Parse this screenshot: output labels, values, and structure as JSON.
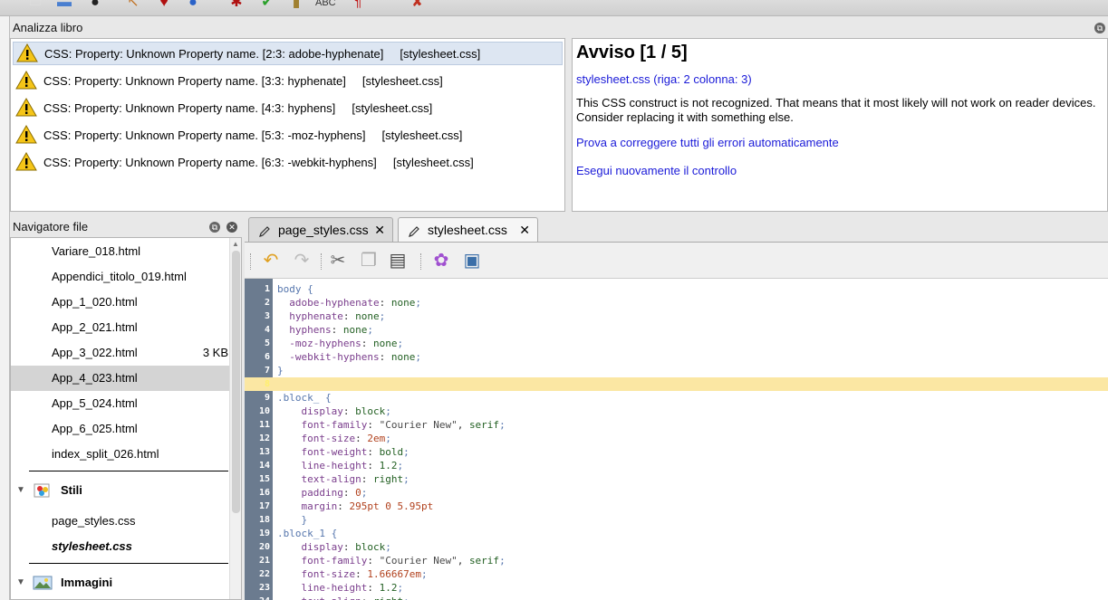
{
  "analyze_panel": {
    "title": "Analizza libro",
    "issues": [
      {
        "text": "CSS: Property: Unknown Property name. [2:3: adobe-hyphenate]     [stylesheet.css]",
        "selected": true
      },
      {
        "text": "CSS: Property: Unknown Property name. [3:3: hyphenate]     [stylesheet.css]",
        "selected": false
      },
      {
        "text": "CSS: Property: Unknown Property name. [4:3: hyphens]     [stylesheet.css]",
        "selected": false
      },
      {
        "text": "CSS: Property: Unknown Property name. [5:3: -moz-hyphens]     [stylesheet.css]",
        "selected": false
      },
      {
        "text": "CSS: Property: Unknown Property name. [6:3: -webkit-hyphens]     [stylesheet.css]",
        "selected": false
      }
    ]
  },
  "detail": {
    "heading": "Avviso [1 / 5]",
    "location_link": "stylesheet.css (riga: 2 colonna: 3)",
    "description": "This CSS construct is not recognized. That means that it most likely will not work on reader devices. Consider replacing it with something else.",
    "fix_all_link": "Prova a correggere tutti gli errori automaticamente",
    "recheck_link": "Esegui nuovamente il controllo"
  },
  "file_navigator": {
    "title": "Navigatore file",
    "files": [
      {
        "name": "Variare_018.html",
        "size": "",
        "selected": false
      },
      {
        "name": "Appendici_titolo_019.html",
        "size": "",
        "selected": false
      },
      {
        "name": "App_1_020.html",
        "size": "",
        "selected": false
      },
      {
        "name": "App_2_021.html",
        "size": "",
        "selected": false
      },
      {
        "name": "App_3_022.html",
        "size": "3 KB",
        "selected": false
      },
      {
        "name": "App_4_023.html",
        "size": "",
        "selected": true
      },
      {
        "name": "App_5_024.html",
        "size": "",
        "selected": false
      },
      {
        "name": "App_6_025.html",
        "size": "",
        "selected": false
      },
      {
        "name": "index_split_026.html",
        "size": "",
        "selected": false
      }
    ],
    "styles_folder": "Stili",
    "styles": [
      {
        "name": "page_styles.css",
        "active": false
      },
      {
        "name": "stylesheet.css",
        "active": true
      }
    ],
    "images_folder": "Immagini"
  },
  "tabs": [
    {
      "label": "page_styles.css",
      "active": false
    },
    {
      "label": "stylesheet.css",
      "active": true
    }
  ],
  "editor": {
    "current_line": 8,
    "lines": [
      [
        {
          "t": "body {",
          "c": "c-sel"
        }
      ],
      [
        {
          "t": "  adobe-hyphenate",
          "c": "c-prop"
        },
        {
          "t": ": ",
          "c": "c-punct"
        },
        {
          "t": "none",
          "c": "c-val"
        },
        {
          "t": ";",
          "c": "c-brace"
        }
      ],
      [
        {
          "t": "  hyphenate",
          "c": "c-prop"
        },
        {
          "t": ": ",
          "c": "c-punct"
        },
        {
          "t": "none",
          "c": "c-val"
        },
        {
          "t": ";",
          "c": "c-brace"
        }
      ],
      [
        {
          "t": "  hyphens",
          "c": "c-prop"
        },
        {
          "t": ": ",
          "c": "c-punct"
        },
        {
          "t": "none",
          "c": "c-val"
        },
        {
          "t": ";",
          "c": "c-brace"
        }
      ],
      [
        {
          "t": "  -moz-hyphens",
          "c": "c-prop"
        },
        {
          "t": ": ",
          "c": "c-punct"
        },
        {
          "t": "none",
          "c": "c-val"
        },
        {
          "t": ";",
          "c": "c-brace"
        }
      ],
      [
        {
          "t": "  -webkit-hyphens",
          "c": "c-prop"
        },
        {
          "t": ": ",
          "c": "c-punct"
        },
        {
          "t": "none",
          "c": "c-val"
        },
        {
          "t": ";",
          "c": "c-brace"
        }
      ],
      [
        {
          "t": "}",
          "c": "c-brace"
        }
      ],
      [],
      [
        {
          "t": ".block_ {",
          "c": "c-sel"
        }
      ],
      [
        {
          "t": "    display",
          "c": "c-prop"
        },
        {
          "t": ": ",
          "c": "c-punct"
        },
        {
          "t": "block",
          "c": "c-val"
        },
        {
          "t": ";",
          "c": "c-brace"
        }
      ],
      [
        {
          "t": "    font-family",
          "c": "c-prop"
        },
        {
          "t": ": ",
          "c": "c-punct"
        },
        {
          "t": "\"Courier New\"",
          "c": "c-str"
        },
        {
          "t": ", ",
          "c": "c-punct"
        },
        {
          "t": "serif",
          "c": "c-val"
        },
        {
          "t": ";",
          "c": "c-brace"
        }
      ],
      [
        {
          "t": "    font-size",
          "c": "c-prop"
        },
        {
          "t": ": ",
          "c": "c-punct"
        },
        {
          "t": "2em",
          "c": "c-num"
        },
        {
          "t": ";",
          "c": "c-brace"
        }
      ],
      [
        {
          "t": "    font-weight",
          "c": "c-prop"
        },
        {
          "t": ": ",
          "c": "c-punct"
        },
        {
          "t": "bold",
          "c": "c-val"
        },
        {
          "t": ";",
          "c": "c-brace"
        }
      ],
      [
        {
          "t": "    line-height",
          "c": "c-prop"
        },
        {
          "t": ": ",
          "c": "c-punct"
        },
        {
          "t": "1.2",
          "c": "c-val"
        },
        {
          "t": ";",
          "c": "c-brace"
        }
      ],
      [
        {
          "t": "    text-align",
          "c": "c-prop"
        },
        {
          "t": ": ",
          "c": "c-punct"
        },
        {
          "t": "right",
          "c": "c-val"
        },
        {
          "t": ";",
          "c": "c-brace"
        }
      ],
      [
        {
          "t": "    padding",
          "c": "c-prop"
        },
        {
          "t": ": ",
          "c": "c-punct"
        },
        {
          "t": "0",
          "c": "c-num"
        },
        {
          "t": ";",
          "c": "c-brace"
        }
      ],
      [
        {
          "t": "    margin",
          "c": "c-prop"
        },
        {
          "t": ": ",
          "c": "c-punct"
        },
        {
          "t": "295pt 0 5.95pt",
          "c": "c-num"
        }
      ],
      [
        {
          "t": "    }",
          "c": "c-brace"
        }
      ],
      [
        {
          "t": ".block_1 {",
          "c": "c-sel"
        }
      ],
      [
        {
          "t": "    display",
          "c": "c-prop"
        },
        {
          "t": ": ",
          "c": "c-punct"
        },
        {
          "t": "block",
          "c": "c-val"
        },
        {
          "t": ";",
          "c": "c-brace"
        }
      ],
      [
        {
          "t": "    font-family",
          "c": "c-prop"
        },
        {
          "t": ": ",
          "c": "c-punct"
        },
        {
          "t": "\"Courier New\"",
          "c": "c-str"
        },
        {
          "t": ", ",
          "c": "c-punct"
        },
        {
          "t": "serif",
          "c": "c-val"
        },
        {
          "t": ";",
          "c": "c-brace"
        }
      ],
      [
        {
          "t": "    font-size",
          "c": "c-prop"
        },
        {
          "t": ": ",
          "c": "c-punct"
        },
        {
          "t": "1.66667em",
          "c": "c-num"
        },
        {
          "t": ";",
          "c": "c-brace"
        }
      ],
      [
        {
          "t": "    line-height",
          "c": "c-prop"
        },
        {
          "t": ": ",
          "c": "c-punct"
        },
        {
          "t": "1.2",
          "c": "c-val"
        },
        {
          "t": ";",
          "c": "c-brace"
        }
      ],
      [
        {
          "t": "    text-align",
          "c": "c-prop"
        },
        {
          "t": ": ",
          "c": "c-punct"
        },
        {
          "t": "right",
          "c": "c-val"
        },
        {
          "t": ";",
          "c": "c-brace"
        }
      ]
    ]
  },
  "colors": {
    "link": "#1a1ad8",
    "gutter": "#6b7b8f",
    "current_line": "#fbe7a3",
    "selection": "#dde6f2"
  }
}
